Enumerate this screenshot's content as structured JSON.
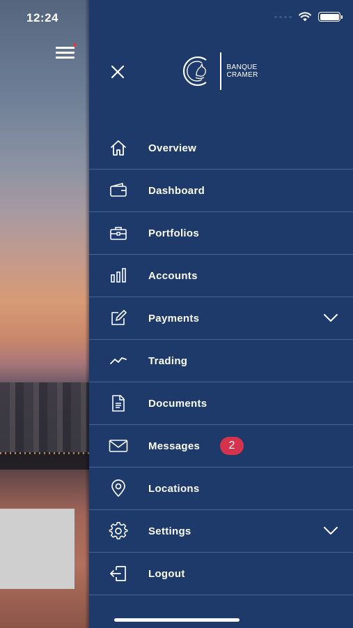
{
  "status_bar": {
    "time": "12:24"
  },
  "brand": {
    "line1": "BANQUE",
    "line2": "CRAMER"
  },
  "menu": [
    {
      "label": "Overview",
      "icon": "home-icon",
      "expandable": false
    },
    {
      "label": "Dashboard",
      "icon": "wallet-icon",
      "expandable": false
    },
    {
      "label": "Portfolios",
      "icon": "briefcase-icon",
      "expandable": false
    },
    {
      "label": "Accounts",
      "icon": "bar-chart-icon",
      "expandable": false
    },
    {
      "label": "Payments",
      "icon": "edit-icon",
      "expandable": true
    },
    {
      "label": "Trading",
      "icon": "trend-line-icon",
      "expandable": false
    },
    {
      "label": "Documents",
      "icon": "document-icon",
      "expandable": false
    },
    {
      "label": "Messages",
      "icon": "envelope-icon",
      "expandable": false,
      "badge": "2"
    },
    {
      "label": "Locations",
      "icon": "location-pin-icon",
      "expandable": false
    },
    {
      "label": "Settings",
      "icon": "gear-icon",
      "expandable": true
    },
    {
      "label": "Logout",
      "icon": "logout-icon",
      "expandable": false
    }
  ],
  "colors": {
    "drawer_bg": "#1d3a6b",
    "divider": "#4a6593",
    "badge": "#d4334b",
    "notification_dot": "#e03a3e"
  }
}
